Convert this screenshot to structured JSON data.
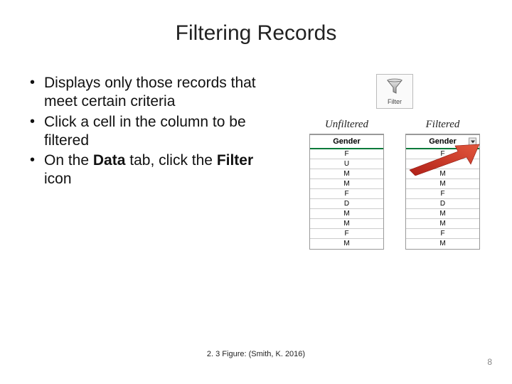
{
  "title": "Filtering Records",
  "bullets": {
    "b1": "Displays only those records that meet certain criteria",
    "b2": "Click a cell in the column to be filtered",
    "b3_pre": "On the ",
    "b3_tab": "Data",
    "b3_mid": " tab, click the ",
    "b3_icon": "Filter",
    "b3_post": " icon"
  },
  "figure": {
    "filter_label": "Filter",
    "unfiltered_title": "Unfiltered",
    "filtered_title": "Filtered",
    "header": "Gender",
    "unfiltered_rows": [
      "F",
      "U",
      "M",
      "M",
      "F",
      "D",
      "M",
      "M",
      "F",
      "M"
    ],
    "filtered_rows": [
      "F",
      "J",
      "M",
      "M",
      "F",
      "D",
      "M",
      "M",
      "F",
      "M"
    ]
  },
  "caption": "2. 3 Figure: (Smith, K. 2016)",
  "page": "8"
}
